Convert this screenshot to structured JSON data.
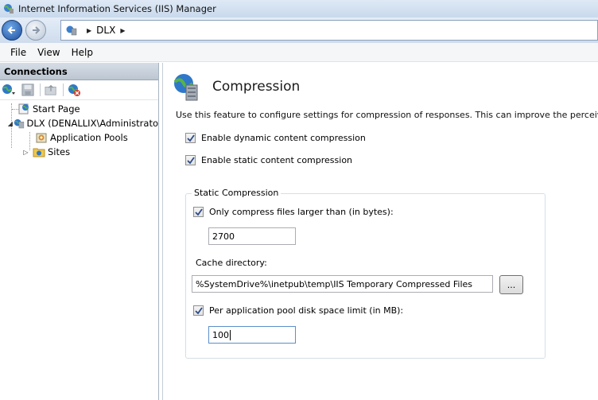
{
  "window": {
    "title": "Internet Information Services (IIS) Manager"
  },
  "address_bar": {
    "crumbs": [
      "DLX"
    ]
  },
  "menu": [
    "File",
    "View",
    "Help"
  ],
  "connections": {
    "header": "Connections",
    "tree": {
      "start_page": "Start Page",
      "server": "DLX (DENALLIX\\Administrato",
      "app_pools": "Application Pools",
      "sites": "Sites"
    }
  },
  "feature": {
    "title": "Compression",
    "description": "Use this feature to configure settings for compression of responses. This can improve the perceived p",
    "dynamic_label": "Enable dynamic content compression",
    "dynamic_checked": true,
    "static_label": "Enable static content compression",
    "static_checked": true,
    "static_group": {
      "legend": "Static Compression",
      "only_larger_label": "Only compress files larger than (in bytes):",
      "only_larger_checked": true,
      "min_size_value": "2700",
      "cache_dir_label": "Cache directory:",
      "cache_dir_value": "%SystemDrive%\\inetpub\\temp\\IIS Temporary Compressed Files",
      "browse_label": "...",
      "per_pool_label": "Per application pool disk space limit (in MB):",
      "per_pool_checked": true,
      "per_pool_value": "100"
    }
  }
}
